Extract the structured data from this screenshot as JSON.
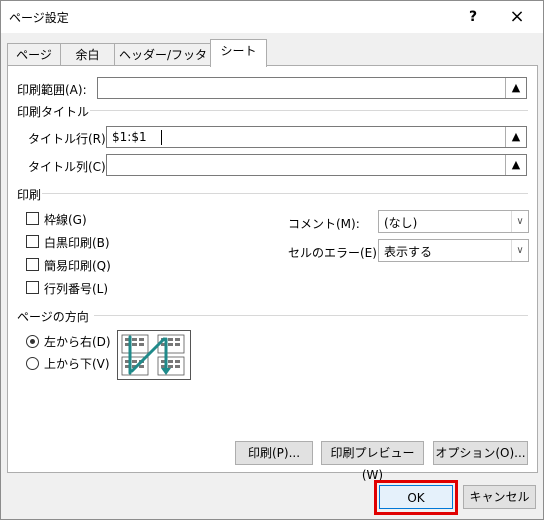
{
  "window": {
    "title": "ページ設定",
    "help": "?",
    "close": "×"
  },
  "tabs": [
    {
      "label": "ページ"
    },
    {
      "label": "余白"
    },
    {
      "label": "ヘッダー/フッター"
    },
    {
      "label": "シート",
      "active": true
    }
  ],
  "print_area": {
    "label": "印刷範囲(A):",
    "value": ""
  },
  "print_titles": {
    "section": "印刷タイトル",
    "rows": {
      "label": "タイトル行(R):",
      "value": "$1:$1"
    },
    "cols": {
      "label": "タイトル列(C):",
      "value": ""
    }
  },
  "print": {
    "section": "印刷",
    "gridlines": "枠線(G)",
    "black_white": "白黒印刷(B)",
    "draft": "簡易印刷(Q)",
    "row_col_headers": "行列番号(L)",
    "comments": {
      "label": "コメント(M):",
      "value": "(なし)"
    },
    "cell_errors": {
      "label": "セルのエラー(E):",
      "value": "表示する"
    }
  },
  "page_order": {
    "section": "ページの方向",
    "down_then_over": "左から右(D)",
    "over_then_down": "上から下(V)",
    "selected": "down_then_over"
  },
  "buttons": {
    "print": "印刷(P)...",
    "preview": "印刷プレビュー(W)",
    "options": "オプション(O)...",
    "ok": "OK",
    "cancel": "キャンセル"
  },
  "colors": {
    "accent": "#0078d7",
    "highlight": "#e00000",
    "diagram_arrow": "#1f8a8a"
  },
  "icons": {
    "collapse": "range-collapse-icon",
    "dropdown": "chevron-down-icon"
  }
}
